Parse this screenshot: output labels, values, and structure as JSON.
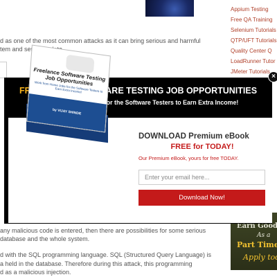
{
  "article": {
    "lines_top": [
      "d as one of the most common attacks as it can bring serious and harmful",
      "tem and sensitive data."
    ],
    "lines_bottom": [
      "any malicious code is entered, then there are possibilities for some serious",
      "database and the whole system.",
      "d with the SQL programming language. SQL (Structured Query Language) is",
      "a held in the database. Therefore during this attack, this programming",
      "d as a malicious injection."
    ]
  },
  "sidebar": {
    "links": [
      "Appium Testing",
      "Free QA Training",
      "Selenium Tutorials",
      "QTP/UFT Tutorials",
      "Quality Center Q",
      "LoadRunner Tutor",
      "JMeter Tutorials"
    ],
    "banner": {
      "line1": "Earn Good M",
      "line2": "As a",
      "line3": "Part Time T",
      "line4": "Apply tod"
    }
  },
  "popup": {
    "close_label": "×",
    "title_accent": "FREELANCE",
    "title_rest": " SOFTWARE TESTING JOB OPPORTUNITIES",
    "subtitle": "Work from Home Jobs for the Software Testers to Earn Extra Income!",
    "book": {
      "title": "Freelance Software Testing Job Opportunities",
      "subtitle": "Work from Home Jobs for the Software Testers to Earn Extra Income!",
      "author": "by VIJAY SHINDE"
    },
    "download_title": "DOWNLOAD Premium eBook",
    "free_title": "FREE for TODAY!",
    "description": "Our Premium eBook, yours for free TODAY.",
    "email_placeholder": "Enter your email here...",
    "button_label": "Download Now!"
  },
  "colors": {
    "accent_orange": "#f6b21b",
    "cta_red": "#c41a1a",
    "sidebar_link": "#b0402a"
  }
}
